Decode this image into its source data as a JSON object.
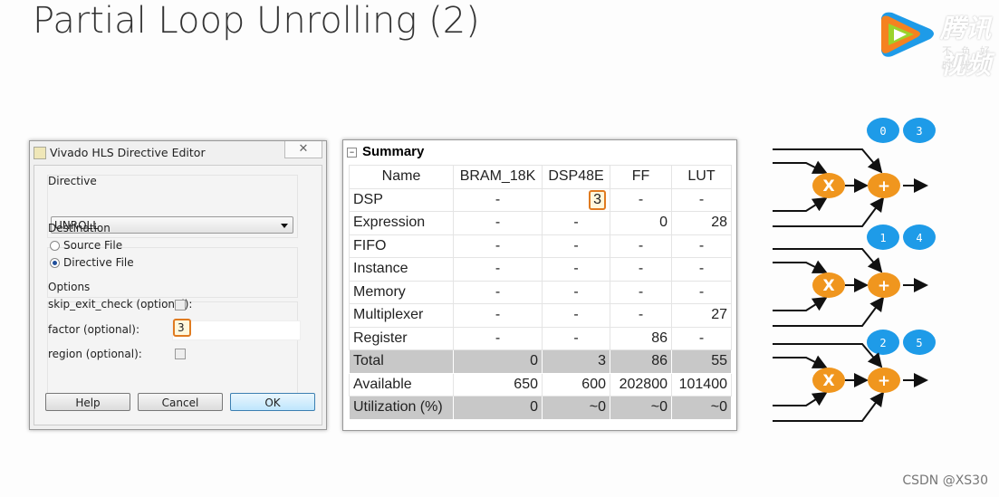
{
  "slide": {
    "title": "Partial Loop Unrolling (2)",
    "watermark": "CSDN @XS30",
    "logo": {
      "text": "腾讯视频",
      "slogan": "不负好时光"
    }
  },
  "dialog": {
    "title": "Vivado HLS Directive Editor",
    "close_label": "✕",
    "directive_label": "Directive",
    "directive_value": "UNROLL",
    "destination_label": "Destination",
    "source_file": "Source File",
    "directive_file": "Directive File",
    "destination_selected": "Directive File",
    "options_label": "Options",
    "skip_exit_check": "skip_exit_check (optional):",
    "skip_exit_check_checked": false,
    "factor": "factor (optional):",
    "factor_value": "3",
    "region": "region (optional):",
    "region_checked": false,
    "help": "Help",
    "cancel": "Cancel",
    "ok": "OK"
  },
  "summary": {
    "title": "Summary",
    "headers": [
      "Name",
      "BRAM_18K",
      "DSP48E",
      "FF",
      "LUT"
    ],
    "rows": [
      [
        "DSP",
        "-",
        "3",
        "-",
        "-"
      ],
      [
        "Expression",
        "-",
        "-",
        "0",
        "28"
      ],
      [
        "FIFO",
        "-",
        "-",
        "-",
        "-"
      ],
      [
        "Instance",
        "-",
        "-",
        "-",
        "-"
      ],
      [
        "Memory",
        "-",
        "-",
        "-",
        "-"
      ],
      [
        "Multiplexer",
        "-",
        "-",
        "-",
        "27"
      ],
      [
        "Register",
        "-",
        "-",
        "86",
        "-"
      ],
      [
        "Total",
        "0",
        "3",
        "86",
        "55"
      ],
      [
        "Available",
        "650",
        "600",
        "202800",
        "101400"
      ],
      [
        "Utilization (%)",
        "0",
        "~0",
        "~0",
        "~0"
      ]
    ]
  },
  "diagram": {
    "mult_label": "X",
    "add_label": "+",
    "stages": [
      {
        "indices": [
          "0",
          "3"
        ]
      },
      {
        "indices": [
          "1",
          "4"
        ]
      },
      {
        "indices": [
          "2",
          "5"
        ]
      }
    ],
    "colors": {
      "op": "#f0961e",
      "index": "#1e9be8"
    }
  }
}
